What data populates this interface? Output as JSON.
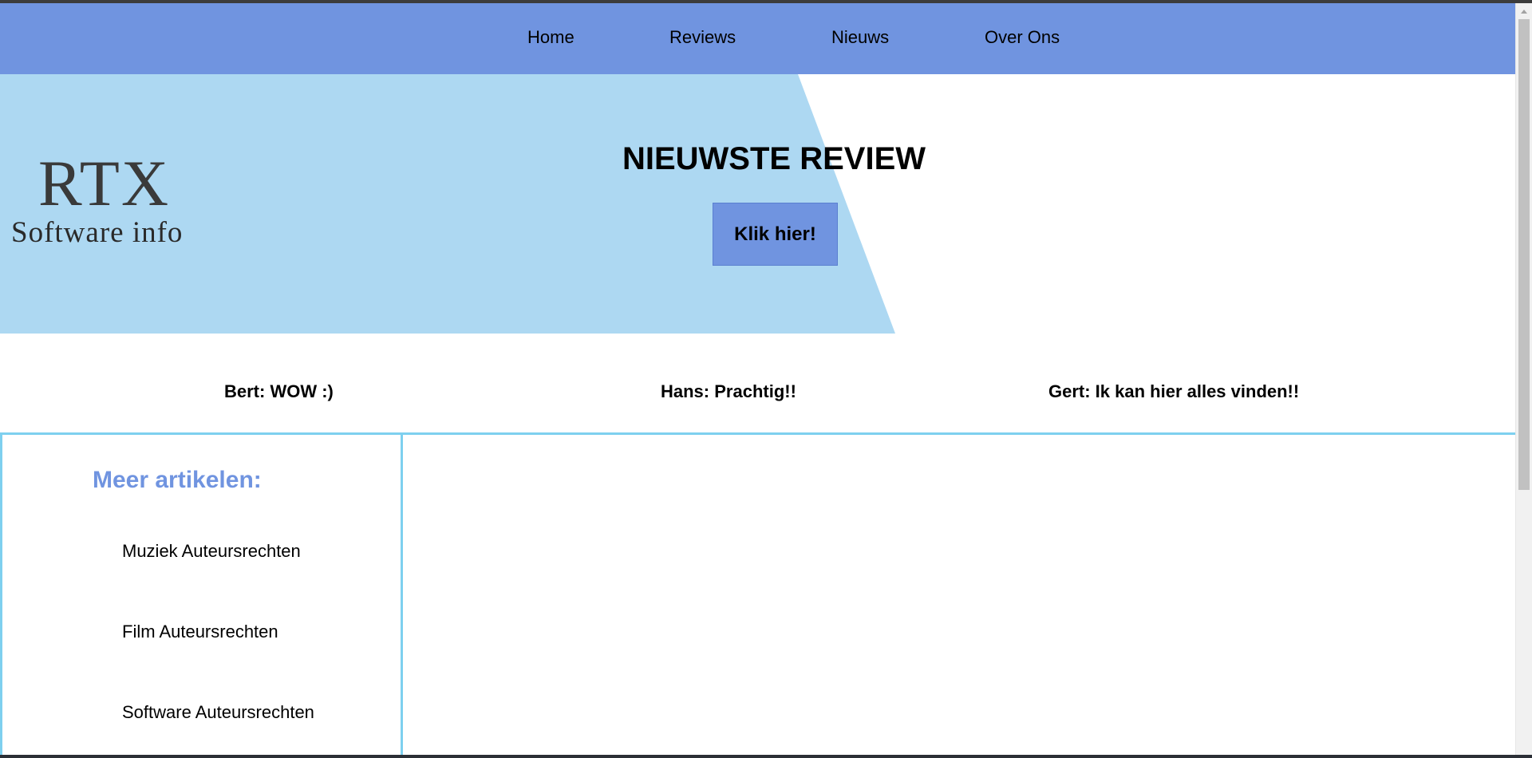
{
  "nav": {
    "items": [
      {
        "label": "Home"
      },
      {
        "label": "Reviews"
      },
      {
        "label": "Nieuws"
      },
      {
        "label": "Over Ons"
      }
    ]
  },
  "logo": {
    "main": "RTX",
    "sub": "Software info"
  },
  "hero": {
    "title": "NIEUWSTE REVIEW",
    "button_label": "Klik hier!"
  },
  "testimonials": [
    {
      "text": "Bert: WOW :)"
    },
    {
      "text": "Hans: Prachtig!!"
    },
    {
      "text": "Gert: Ik kan hier alles vinden!!"
    }
  ],
  "sidebar": {
    "title": "Meer artikelen:",
    "links": [
      {
        "label": "Muziek Auteursrechten"
      },
      {
        "label": "Film Auteursrechten"
      },
      {
        "label": "Software Auteursrechten"
      }
    ]
  },
  "colors": {
    "nav_bg": "#7094e0",
    "hero_light_blue": "#add8f2",
    "accent_border": "#7ed0ef",
    "sidebar_title": "#7094e0"
  }
}
